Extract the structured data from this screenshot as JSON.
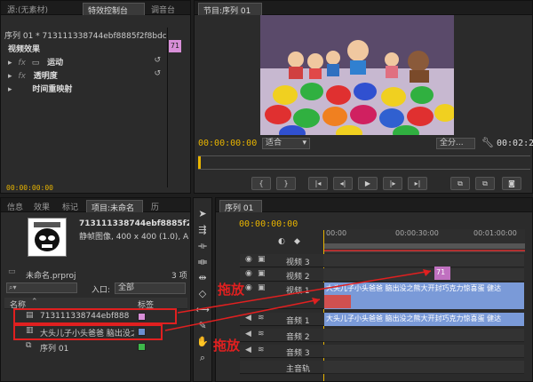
{
  "top_left": {
    "tabs": [
      "源:(无素材)",
      "特效控制台",
      "调音台"
    ],
    "sequence_label": "序列 01 * 713111338744ebf8885f2f8bdcf9d...",
    "clip_badge": "71",
    "section_title": "视频效果",
    "effects": [
      "运动",
      "透明度",
      "时间重映射"
    ],
    "timecode": "00:00:00:00"
  },
  "program": {
    "tab": "节目:序列 01",
    "timecode": "00:00:00:00",
    "fit_label": "适合",
    "quality_label": "全分...",
    "duration": "00:02:2"
  },
  "project": {
    "tabs": [
      "信息",
      "效果",
      "标记",
      "项目:未命名",
      "历"
    ],
    "preview_title": "713111338744ebf8885f2f...",
    "preview_desc": "静帧图像, 400 x 400 (1.0), Al...",
    "project_name": "未命名.prproj",
    "item_count": "3 项",
    "inpoint_label": "入口:",
    "inpoint_value": "全部",
    "col_name": "名称",
    "col_label": "标签",
    "items": [
      {
        "name": "713111338744ebf8885f2f8",
        "color": "#d88fd8"
      },
      {
        "name": "大头儿子小头爸爸 脑出没之",
        "color": "#6a8fd0"
      },
      {
        "name": "序列 01",
        "color": "#3db84a"
      }
    ]
  },
  "timeline": {
    "tab": "序列 01",
    "timecode": "00:00:00:00",
    "ruler": [
      "00:00",
      "00:00:30:00",
      "00:01:00:00"
    ],
    "tracks": [
      "视频 3",
      "视频 2",
      "视频 1",
      "音频 1",
      "音频 2",
      "音频 3",
      "主音轨"
    ],
    "clip_image": "71",
    "clip_video": "大头儿子小头爸爸 脑出没之熊大开封巧克力惊喜蛋 健达",
    "clip_audio": "大头儿子小头爸爸 脑出没之熊大开封巧克力惊喜蛋 健达"
  },
  "annotations": [
    "拖放",
    "拖放"
  ]
}
